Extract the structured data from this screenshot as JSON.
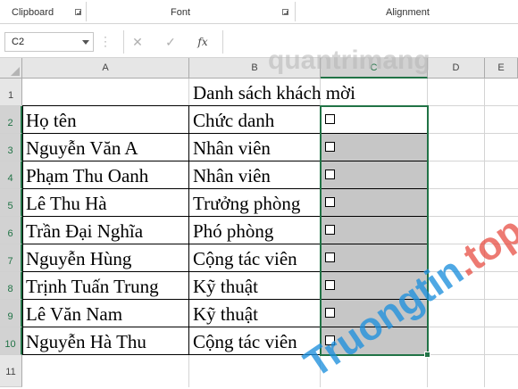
{
  "ribbon": {
    "groups": [
      {
        "label": "Clipboard"
      },
      {
        "label": "Font"
      },
      {
        "label": "Alignment"
      }
    ]
  },
  "formula_bar": {
    "name_box": "C2",
    "cancel_icon": "✕",
    "enter_icon": "✓",
    "fx_label": "fx",
    "formula": ""
  },
  "grid": {
    "columns": [
      "A",
      "B",
      "C",
      "D",
      "E"
    ],
    "selected_column": "C",
    "rows": [
      "1",
      "2",
      "3",
      "4",
      "5",
      "6",
      "7",
      "8",
      "9",
      "10",
      "11"
    ],
    "selected_rows": [
      "2",
      "3",
      "4",
      "5",
      "6",
      "7",
      "8",
      "9",
      "10"
    ],
    "title": "Danh sách khách mời",
    "table": [
      {
        "name": "Họ tên",
        "role": "Chức danh"
      },
      {
        "name": "Nguyễn Văn A",
        "role": "Nhân viên"
      },
      {
        "name": "Phạm Thu Oanh",
        "role": "Nhân viên"
      },
      {
        "name": "Lê Thu Hà",
        "role": "Trưởng phòng"
      },
      {
        "name": "Trần Đại Nghĩa",
        "role": "Phó phòng"
      },
      {
        "name": "Nguyễn Hùng",
        "role": "Cộng tác viên"
      },
      {
        "name": "Trịnh Tuấn Trung",
        "role": "Kỹ thuật"
      },
      {
        "name": "Lê Văn Nam",
        "role": "Kỹ thuật"
      },
      {
        "name": "Nguyễn Hà Thu",
        "role": "Cộng tác viên"
      }
    ],
    "checkbox_fill": "#c6c6c6",
    "selection_color": "#217346"
  },
  "watermarks": {
    "top": "quantrimang",
    "diag_main": "Truongtin",
    "diag_suffix": ".top"
  }
}
